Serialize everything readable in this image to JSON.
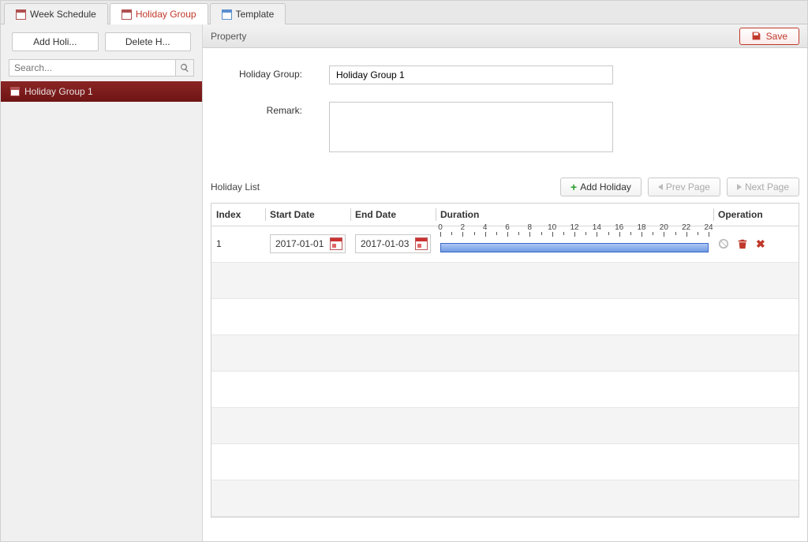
{
  "tabs": {
    "week_schedule": "Week Schedule",
    "holiday_group": "Holiday Group",
    "template": "Template",
    "active_index": 1
  },
  "sidebar": {
    "add_label": "Add Holi...",
    "delete_label": "Delete H...",
    "search_placeholder": "Search...",
    "items": [
      {
        "label": "Holiday Group 1"
      }
    ]
  },
  "property": {
    "header": "Property",
    "save_label": "Save",
    "group_label": "Holiday Group:",
    "group_value": "Holiday Group 1",
    "remark_label": "Remark:",
    "remark_value": ""
  },
  "holiday_list": {
    "title": "Holiday List",
    "add_label": "Add Holiday",
    "prev_label": "Prev Page",
    "next_label": "Next Page",
    "columns": {
      "index": "Index",
      "start": "Start Date",
      "end": "End Date",
      "duration": "Duration",
      "operation": "Operation"
    },
    "rows": [
      {
        "index": "1",
        "start_date": "2017-01-01",
        "end_date": "2017-01-03",
        "duration_start_hour": 0,
        "duration_end_hour": 24
      }
    ],
    "empty_row_count": 7,
    "timeline_major_ticks": [
      0,
      2,
      4,
      6,
      8,
      10,
      12,
      14,
      16,
      18,
      20,
      22,
      24
    ]
  }
}
